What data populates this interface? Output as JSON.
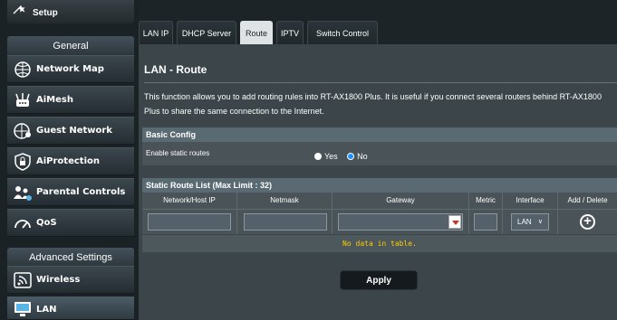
{
  "sidebar": {
    "setup_label": "Setup",
    "general_label": "General",
    "advanced_label": "Advanced Settings",
    "items": [
      {
        "label": "Network Map",
        "icon": "network-map-icon"
      },
      {
        "label": "AiMesh",
        "icon": "aimesh-icon"
      },
      {
        "label": "Guest Network",
        "icon": "guest-network-icon"
      },
      {
        "label": "AiProtection",
        "icon": "shield-lock-icon"
      },
      {
        "label": "Parental Controls",
        "icon": "parental-controls-icon"
      },
      {
        "label": "QoS",
        "icon": "gauge-icon"
      }
    ],
    "advanced_items": [
      {
        "label": "Wireless",
        "icon": "wireless-icon"
      },
      {
        "label": "LAN",
        "icon": "monitor-icon",
        "active": true
      }
    ]
  },
  "tabs": [
    {
      "label": "LAN IP"
    },
    {
      "label": "DHCP Server"
    },
    {
      "label": "Route",
      "active": true
    },
    {
      "label": "IPTV"
    },
    {
      "label": "Switch Control"
    }
  ],
  "main": {
    "title": "LAN - Route",
    "description": "This function allows you to add routing rules into RT-AX1800 Plus. It is useful if you connect several routers behind RT-AX1800 Plus to share the same connection to the Internet.",
    "basic_config": {
      "header": "Basic Config",
      "static_label": "Enable static routes",
      "yes_label": "Yes",
      "no_label": "No",
      "selected": "No"
    },
    "route_list": {
      "header": "Static Route List (Max Limit : 32)",
      "columns": [
        "Network/Host IP",
        "Netmask",
        "Gateway",
        "Metric",
        "Interface",
        "Add / Delete"
      ],
      "interface_value": "LAN",
      "no_data": "No data in table."
    },
    "apply_label": "Apply"
  },
  "colors": {
    "accent_radio": "#1e90ff",
    "no_data_text": "#ffcc00",
    "gateway_arrow": "#c0392b"
  }
}
